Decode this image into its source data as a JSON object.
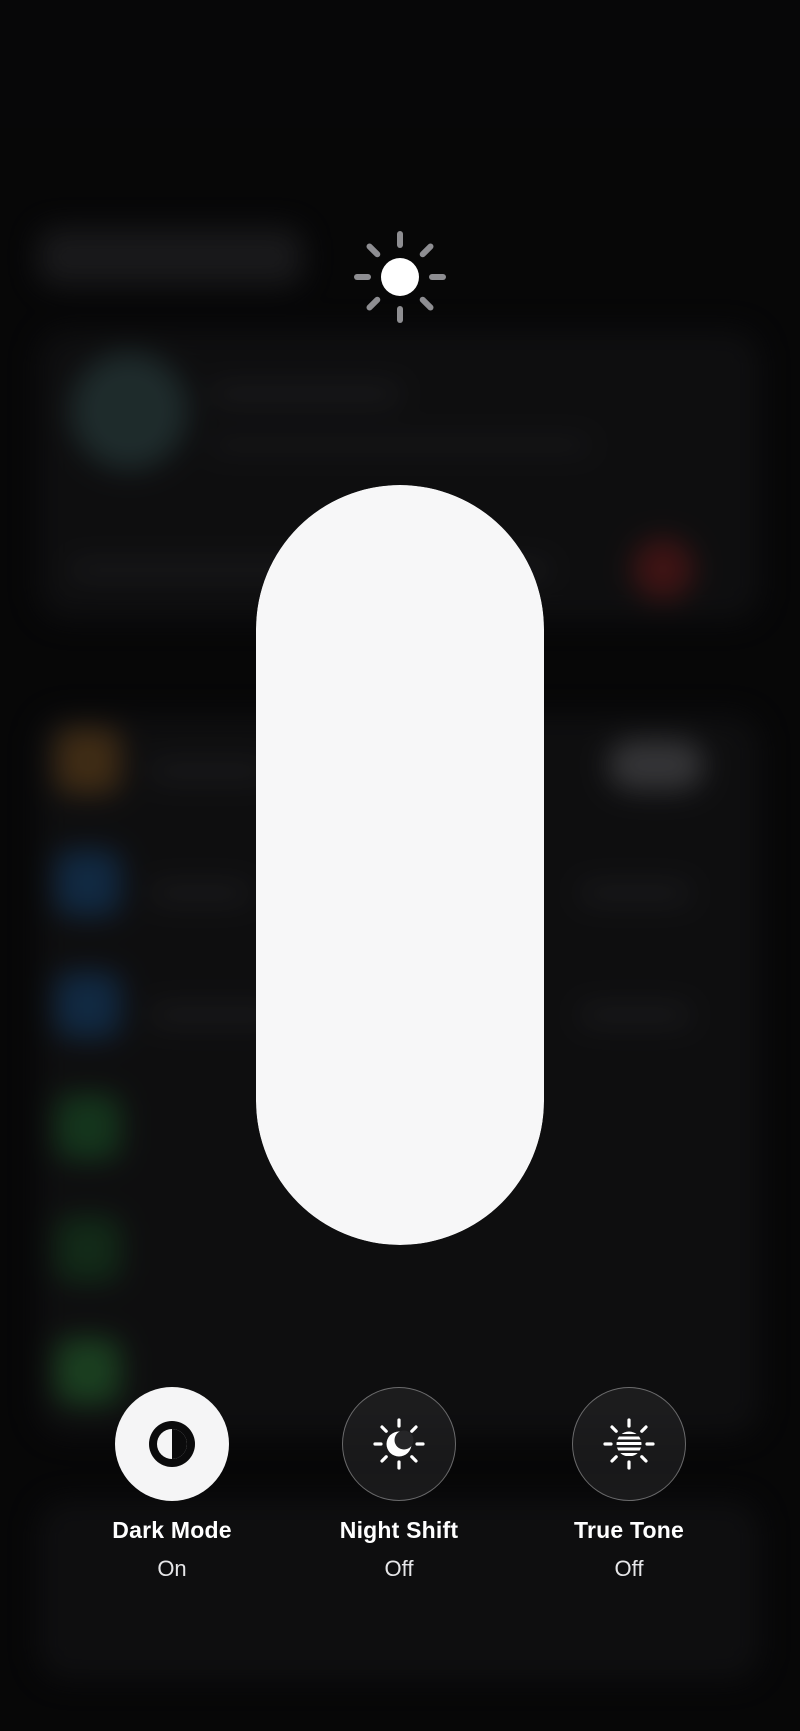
{
  "brightness": {
    "level": 1.0,
    "icon": "sun-icon"
  },
  "toggles": [
    {
      "label": "Dark Mode",
      "state": "On",
      "icon": "dark-mode-icon",
      "active": true
    },
    {
      "label": "Night Shift",
      "state": "Off",
      "icon": "night-shift-icon",
      "active": false
    },
    {
      "label": "True Tone",
      "state": "Off",
      "icon": "true-tone-icon",
      "active": false
    }
  ],
  "colors": {
    "background": "#0b0b0c",
    "slider_fill": "#f7f7f8",
    "toggle_on": "#f5f5f6"
  }
}
